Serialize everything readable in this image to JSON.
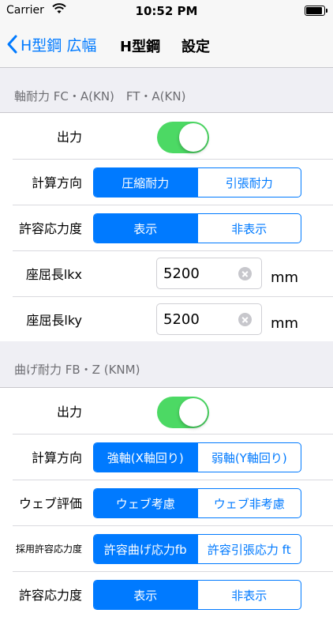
{
  "status_bar": {
    "carrier": "Carrier",
    "time": "10:52 PM"
  },
  "nav": {
    "back_label": "H型鋼 広幅",
    "title": "H型鋼",
    "settings_label": "設定"
  },
  "section_axial": {
    "header": "軸耐力 FC・A(KN)　FT・A(KN)",
    "output_label": "出力",
    "output_on": true,
    "direction_label": "計算方向",
    "direction_options": [
      "圧縮耐力",
      "引張耐力"
    ],
    "allowable_label": "許容応力度",
    "allowable_options": [
      "表示",
      "非表示"
    ],
    "lkx_label": "座屈長lkx",
    "lkx_value": "5200",
    "lky_label": "座屈長lky",
    "lky_value": "5200",
    "unit": "mm"
  },
  "section_bending": {
    "header": "曲げ耐力 FB・Z (KNM)",
    "output_label": "出力",
    "output_on": true,
    "direction_label": "計算方向",
    "direction_options": [
      "強軸(X軸回り)",
      "弱軸(Y軸回り)"
    ],
    "web_label": "ウェブ評価",
    "web_options": [
      "ウェブ考慮",
      "ウェブ非考慮"
    ],
    "adopted_label": "採用許容応力度",
    "adopted_options": [
      "許容曲げ応力fb",
      "許容引張応力 ft"
    ],
    "allowable_label": "許容応力度",
    "allowable_options": [
      "表示",
      "非表示"
    ]
  },
  "colors": {
    "accent": "#007aff",
    "switch_on": "#4cd964",
    "background": "#efeff4"
  },
  "icons": {
    "back": "chevron-left-icon",
    "wifi": "wifi-icon",
    "battery": "battery-icon",
    "clear": "clear-icon"
  }
}
